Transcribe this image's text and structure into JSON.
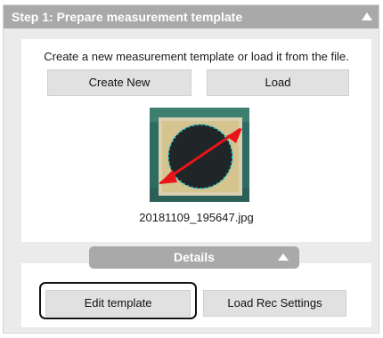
{
  "step": {
    "title": "Step 1: Prepare measurement template",
    "collapse_icon": "triangle-up-icon"
  },
  "prepare": {
    "instruction": "Create a new measurement template or load it from the file.",
    "create_new_label": "Create New",
    "load_label": "Load",
    "image_filename": "20181109_195647.jpg"
  },
  "details": {
    "label": "Details",
    "toggle_icon": "triangle-up-icon",
    "edit_template_label": "Edit template",
    "load_rec_settings_label": "Load Rec Settings"
  },
  "colors": {
    "header_bg": "#a9a9a9",
    "panel_bg": "#ebebeb",
    "button_bg": "#e1e1e1",
    "marker": "#e8141a",
    "contour": "#28d4e0"
  }
}
